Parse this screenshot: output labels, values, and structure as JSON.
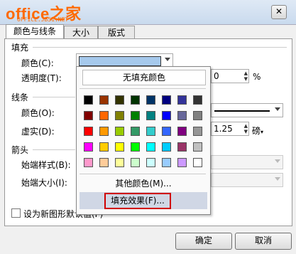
{
  "titlebar": {
    "logo": "office之家",
    "logo_sub": "OFFICE.JB51.NET",
    "close": "✕"
  },
  "tabs": [
    {
      "label": "颜色与线条"
    },
    {
      "label": "大小"
    },
    {
      "label": "版式"
    }
  ],
  "fill": {
    "section": "填充",
    "color_label": "颜色(C):",
    "transparency_label": "透明度(T):",
    "transparency_value": "0",
    "percent": "%"
  },
  "line": {
    "section": "线条",
    "color_label": "颜色(O):",
    "dash_label": "虚实(D):",
    "weight_value": "1.25",
    "weight_unit": "磅"
  },
  "arrows": {
    "section": "箭头",
    "begin_style_label": "始端样式(B):",
    "begin_size_label": "始端大小(I):"
  },
  "default_checkbox": "设为新图形默认值(F)",
  "buttons": {
    "ok": "确定",
    "cancel": "取消"
  },
  "dropdown": {
    "no_fill": "无填充颜色",
    "more_colors": "其他颜色(M)...",
    "fill_effects": "填充效果(F)...",
    "palette": [
      [
        "#000000",
        "#993300",
        "#333300",
        "#003300",
        "#003366",
        "#000080",
        "#333399",
        "#333333"
      ],
      [
        "#800000",
        "#ff6600",
        "#808000",
        "#008000",
        "#008080",
        "#0000ff",
        "#666699",
        "#808080"
      ],
      [
        "#ff0000",
        "#ff9900",
        "#99cc00",
        "#339966",
        "#33cccc",
        "#3366ff",
        "#800080",
        "#969696"
      ],
      [
        "#ff00ff",
        "#ffcc00",
        "#ffff00",
        "#00ff00",
        "#00ffff",
        "#00ccff",
        "#993366",
        "#c0c0c0"
      ],
      [
        "#ff99cc",
        "#ffcc99",
        "#ffff99",
        "#ccffcc",
        "#ccffff",
        "#99ccff",
        "#cc99ff",
        "#ffffff"
      ]
    ]
  },
  "colors": {
    "selected_fill": "#a6c9ec",
    "highlight": "#d0d7e5",
    "focus_border": "#d00000"
  }
}
